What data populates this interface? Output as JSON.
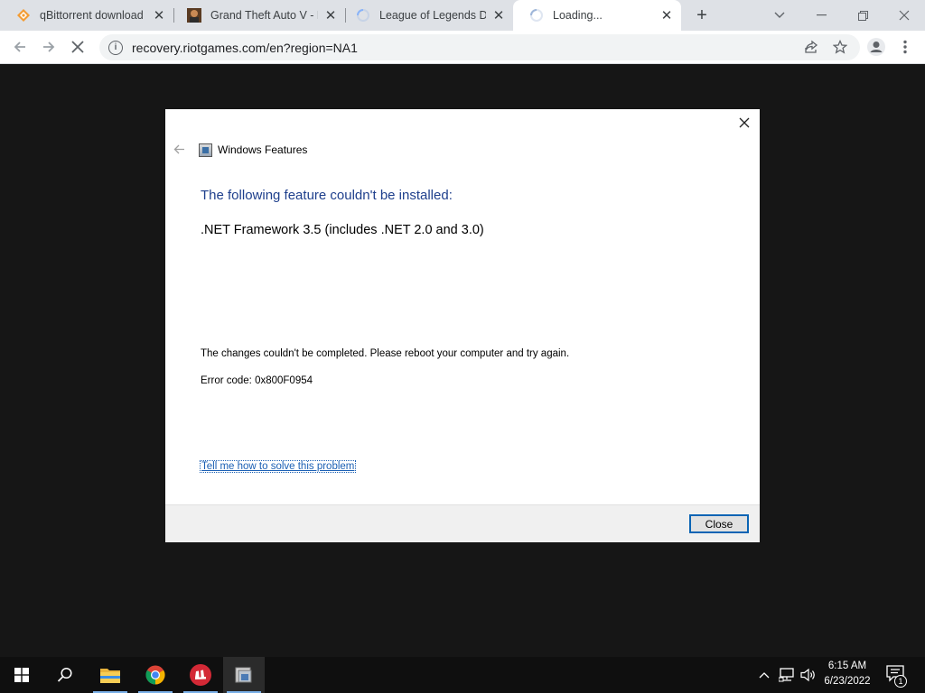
{
  "browser": {
    "tabs": [
      {
        "title": "qBittorrent download |",
        "icon": "qbittorrent-icon"
      },
      {
        "title": "Grand Theft Auto V - F",
        "icon": "gta-icon"
      },
      {
        "title": "League of Legends Do",
        "icon": "loading-spinner-icon"
      },
      {
        "title": "Loading...",
        "icon": "loading-spinner-icon",
        "active": true
      }
    ],
    "new_tab_symbol": "+",
    "address": "recovery.riotgames.com/en?region=NA1",
    "info_symbol": "i"
  },
  "dialog": {
    "app_title": "Windows Features",
    "heading": "The following feature couldn't be installed:",
    "feature": ".NET Framework 3.5 (includes .NET 2.0 and 3.0)",
    "message": "The changes couldn't be completed. Please reboot your computer and try again.",
    "error_code": "Error code: 0x800F0954",
    "help_link": "Tell me how to solve this problem",
    "close_button": "Close"
  },
  "taskbar": {
    "apps": [
      "start",
      "search",
      "file-explorer",
      "chrome",
      "riot-client",
      "windows-features"
    ],
    "clock_time": "6:15 AM",
    "clock_date": "6/23/2022",
    "notification_count": "1"
  },
  "colors": {
    "heading": "#1e3f8c",
    "link": "#1a5fb4",
    "page_background": "#161616",
    "tabstrip": "#dee1e6"
  }
}
